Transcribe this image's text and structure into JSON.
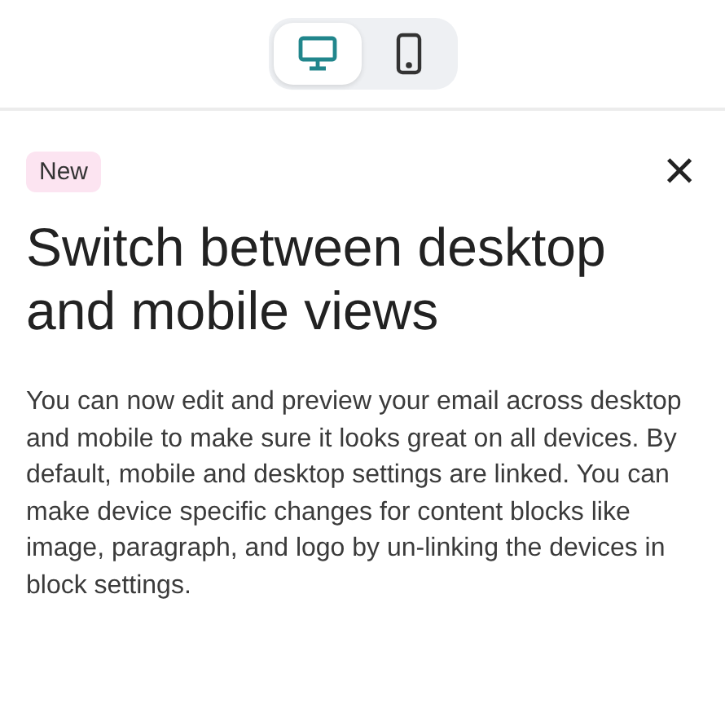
{
  "view_toggle": [
    {
      "kind": "desktop",
      "selected": true
    },
    {
      "kind": "mobile",
      "selected": false
    }
  ],
  "badge": "New",
  "close": "×",
  "title": "Switch between desktop and mobile views",
  "body": "You can now edit and preview your email across desktop and mobile to make sure it looks great on all devices. By default, mobile and desktop settings are linked. You can make device specific changes for content blocks like image, paragraph, and logo by un-linking the devices in block settings."
}
